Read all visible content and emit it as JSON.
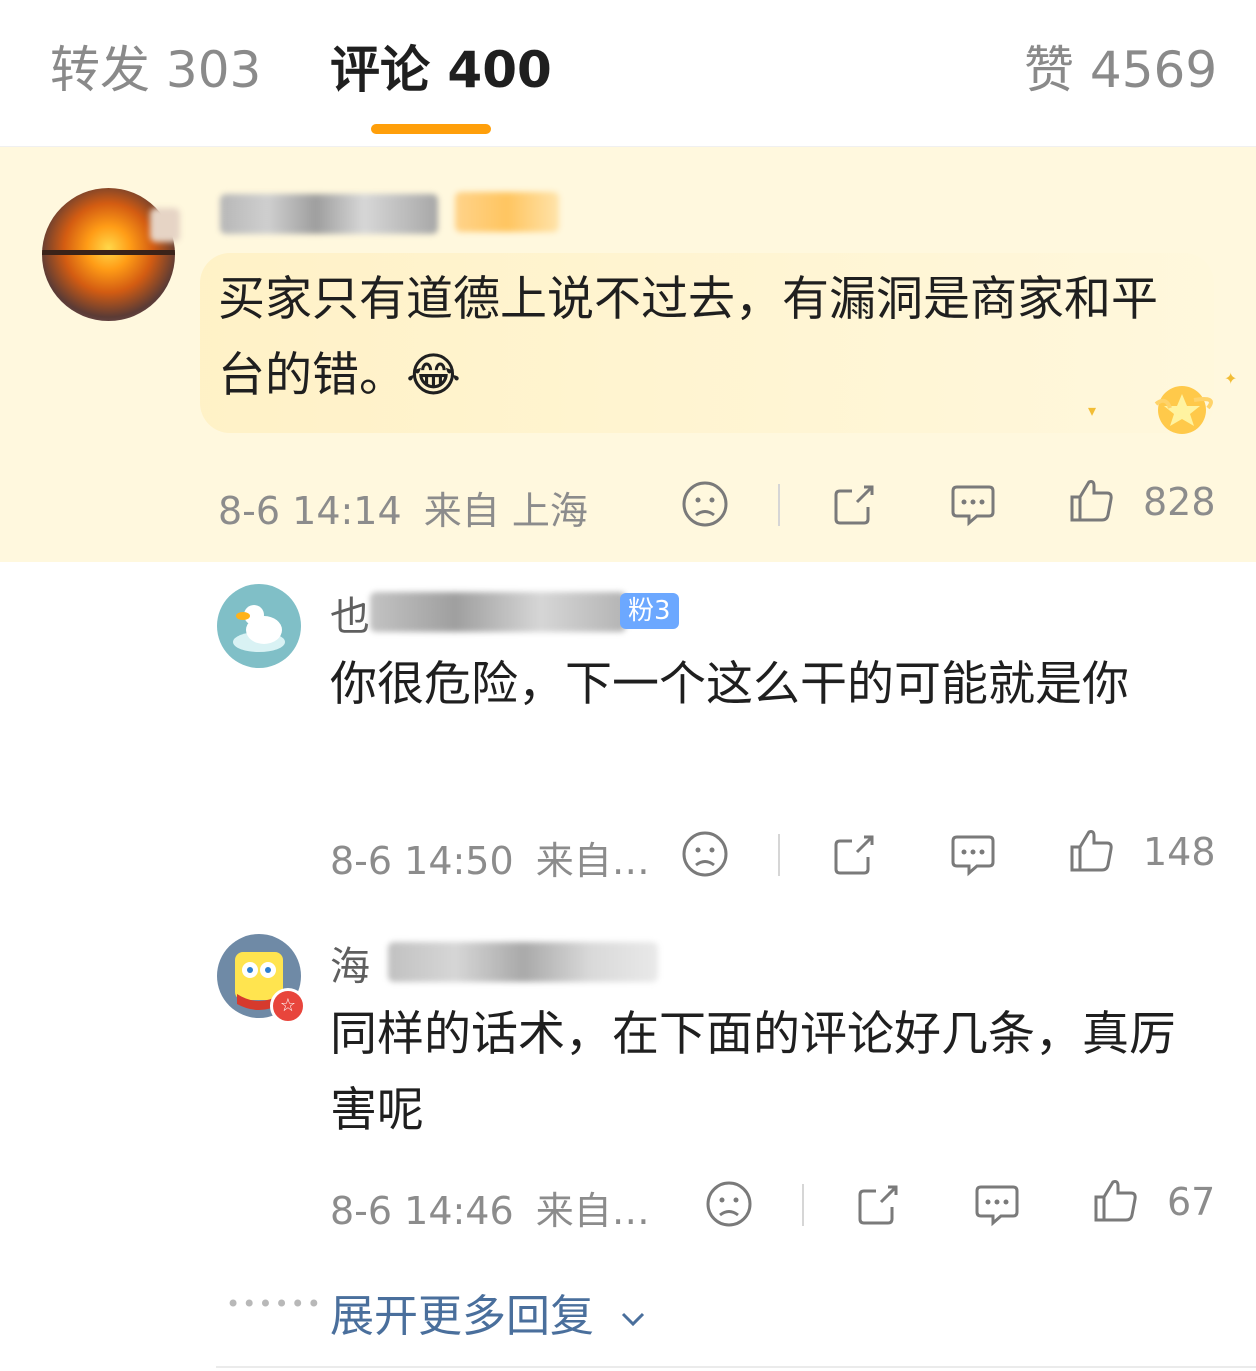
{
  "tabs": {
    "repost": "转发 303",
    "comments": "评论 400",
    "likes": "赞 4569"
  },
  "comments": [
    {
      "text": "买家只有道德上说不过去，有漏洞是商家和平台的错。😂",
      "time": "8-6 14:14",
      "location": "来自 上海",
      "likes": "828"
    },
    {
      "username_prefix": "也",
      "badge": "粉3",
      "text": "你很危险，下一个这么干的可能就是你",
      "time": "8-6 14:50",
      "location": "来自…",
      "likes": "148"
    },
    {
      "username_prefix": "海",
      "text": "同样的话术，在下面的评论好几条，真厉害呢",
      "time": "8-6 14:46",
      "location": "来自…",
      "likes": "67"
    }
  ],
  "expand_replies": "展开更多回复",
  "colors": {
    "accent": "#ff9f0a",
    "highlight_bg": "#fff8de",
    "link": "#4a6f9c"
  },
  "icons": [
    "sad-face-icon",
    "share-icon",
    "comment-icon",
    "thumb-up-icon",
    "chevron-down-icon"
  ]
}
